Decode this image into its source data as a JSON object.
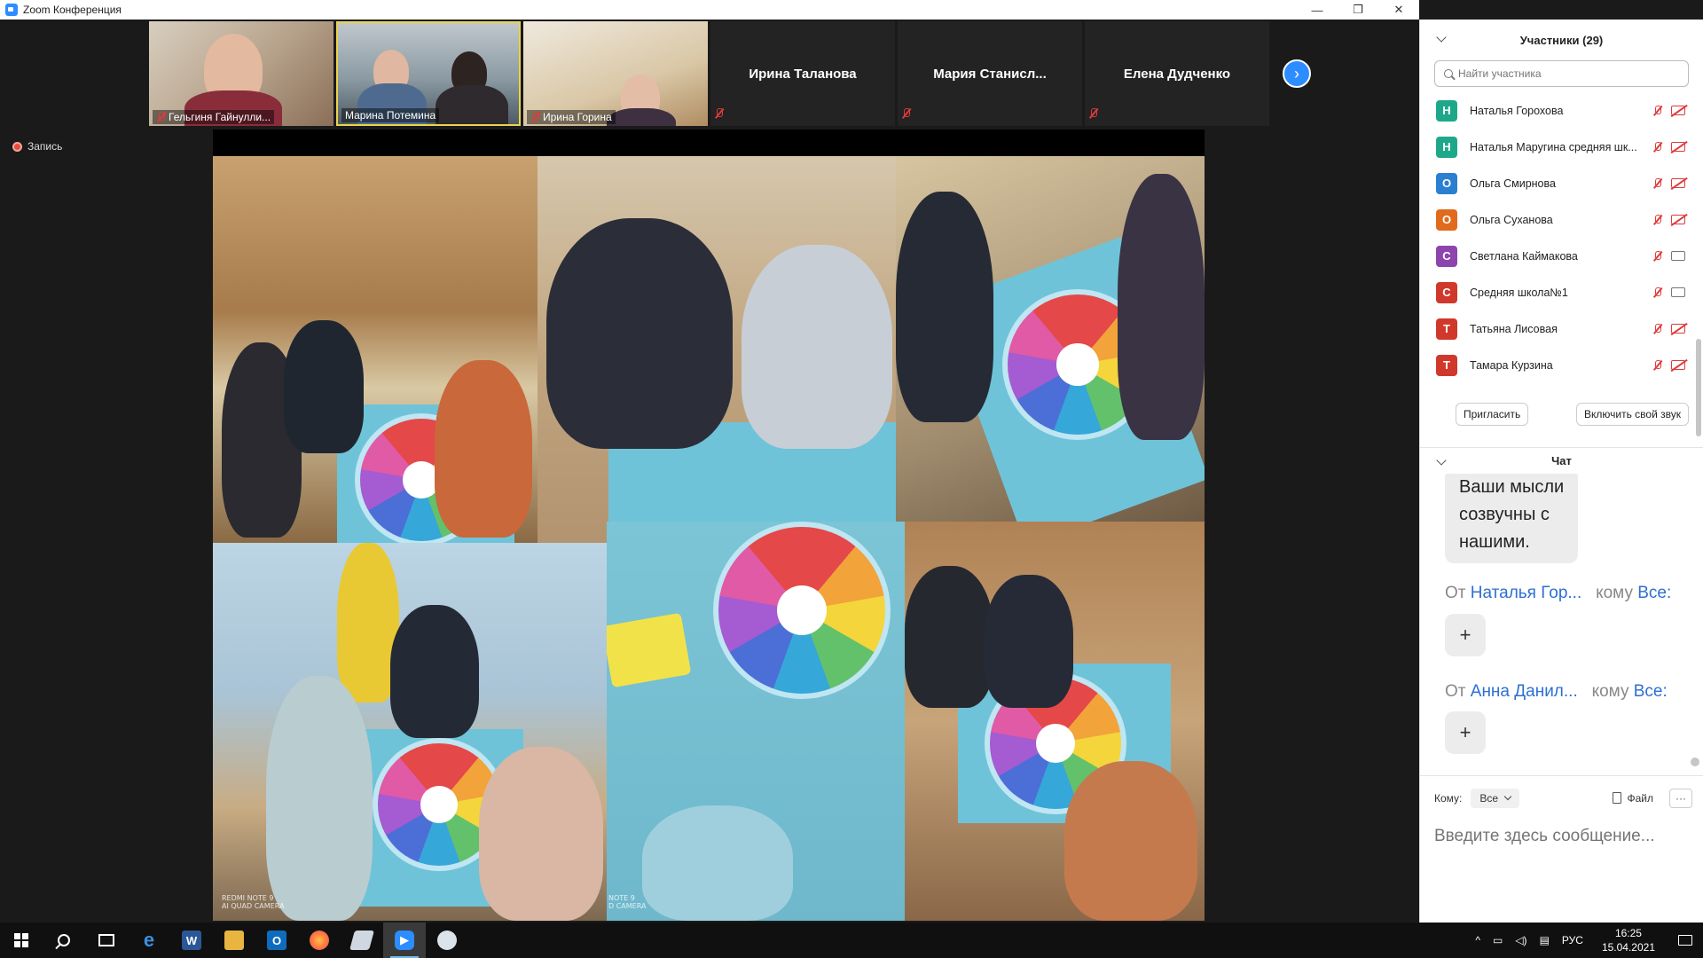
{
  "window": {
    "title": "Zoom Конференция",
    "controls": [
      "—",
      "❐",
      "✕"
    ]
  },
  "thumbnails": [
    {
      "name": "Гельгиня Гайнулли...",
      "muted": true
    },
    {
      "name": "Марина Потемина",
      "muted": false,
      "active_speaker": true
    },
    {
      "name": "Ирина Горина",
      "muted": true
    },
    {
      "name": "Ирина Таланова",
      "muted": true
    },
    {
      "name": "Мария  Станисл...",
      "muted": true
    },
    {
      "name": "Елена Дудченко",
      "muted": true
    }
  ],
  "recording": {
    "label": "Запись"
  },
  "share": {
    "captions": [
      "REDMI NOTE 9\nAI QUAD CAMERA",
      "NOTE 9\nD CAMERA",
      "REDMI NOTE 9\nAI QUAD CAMERA"
    ]
  },
  "participants_panel": {
    "title": "Участники (29)",
    "search_placeholder": "Найти участника",
    "participants": [
      {
        "initial": "Н",
        "name": "Наталья Горохова",
        "color": "#1ea88a",
        "video": false
      },
      {
        "initial": "Н",
        "name": "Наталья Маругина средняя шк...",
        "color": "#1ea88a",
        "video": false
      },
      {
        "initial": "О",
        "name": "Ольга Смирнова",
        "color": "#2b7fd1",
        "video": false
      },
      {
        "initial": "О",
        "name": "Ольга Суханова",
        "color": "#e06a1e",
        "video": false
      },
      {
        "initial": "С",
        "name": "Светлана Каймакова",
        "color": "#8e44ad",
        "video": true
      },
      {
        "initial": "С",
        "name": "Средняя школа№1",
        "color": "#d0382b",
        "video": true
      },
      {
        "initial": "Т",
        "name": "Татьяна Лисовая",
        "color": "#d0382b",
        "video": false
      },
      {
        "initial": "Т",
        "name": "Тамара Курзина",
        "color": "#d0382b",
        "video": false
      }
    ],
    "invite_label": "Пригласить",
    "unmute_label": "Включить свой звук"
  },
  "chat": {
    "title": "Чат",
    "message_text": "Ваши мысли\nсозвучны с\nнашими.",
    "from_label": "От",
    "to_label": "кому",
    "messages": [
      {
        "from": "Наталья Гор...",
        "to": "Все:",
        "content": "+"
      },
      {
        "from": "Анна Данил...",
        "to": "Все:",
        "content": "+"
      }
    ],
    "compose": {
      "to_prefix": "Кому:",
      "to_value": "Все",
      "file_label": "Файл",
      "more_label": "···",
      "placeholder": "Введите здесь сообщение..."
    }
  },
  "taskbar": {
    "apps": [
      "start",
      "search",
      "task-view",
      "edge",
      "word",
      "explorer",
      "outlook",
      "firefox",
      "app",
      "zoom",
      "paint"
    ],
    "tray": {
      "up_arrow": "^",
      "language": "РУС",
      "time": "16:25",
      "date": "15.04.2021"
    }
  }
}
